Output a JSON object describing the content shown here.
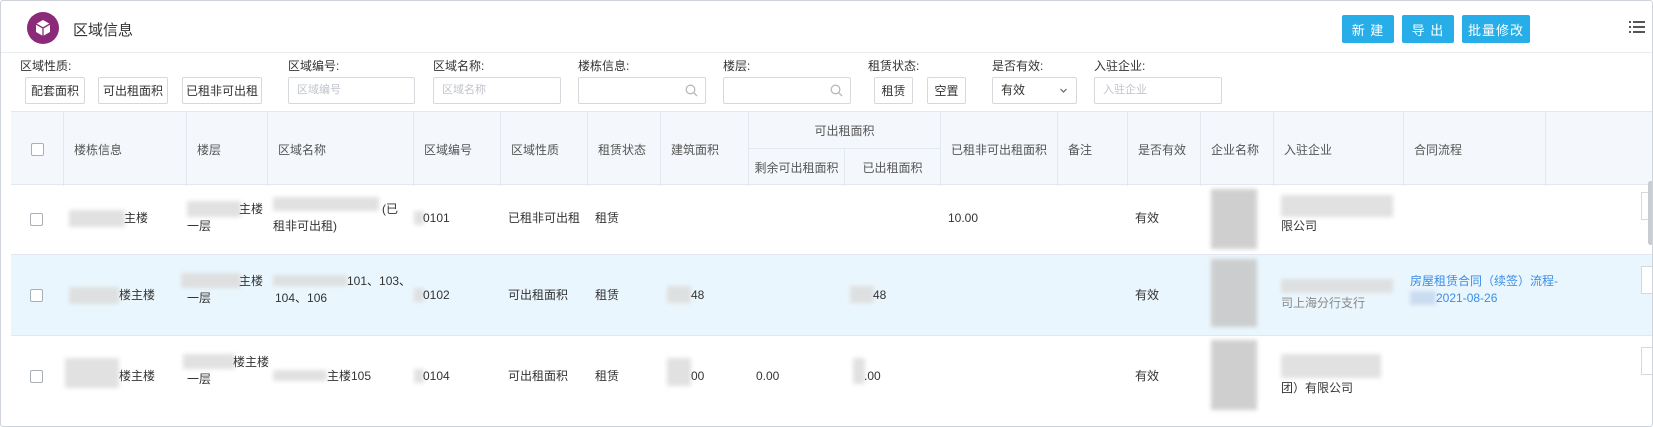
{
  "header": {
    "title": "区域信息",
    "buttons": {
      "new": "新 建",
      "export": "导 出",
      "batch_edit": "批量修改"
    }
  },
  "filters": {
    "area_nature": {
      "label": "区域性质:",
      "options": [
        "配套面积",
        "可出租面积",
        "已租非可出租"
      ]
    },
    "area_code": {
      "label": "区域编号:",
      "placeholder": "区域编号"
    },
    "area_name": {
      "label": "区域名称:",
      "placeholder": "区域名称"
    },
    "building": {
      "label": "楼栋信息:"
    },
    "floor": {
      "label": "楼层:"
    },
    "lease_status": {
      "label": "租赁状态:",
      "options": [
        "租赁",
        "空置"
      ]
    },
    "valid": {
      "label": "是否有效:",
      "value": "有效"
    },
    "tenant": {
      "label": "入驻企业:",
      "placeholder": "入驻企业"
    }
  },
  "table": {
    "columns": {
      "building": "楼栋信息",
      "floor": "楼层",
      "area_name": "区域名称",
      "area_code": "区域编号",
      "area_nature": "区域性质",
      "lease_status": "租赁状态",
      "build_area": "建筑面积",
      "rentable_group": "可出租面积",
      "remaining": "剩余可出租面积",
      "rented": "已出租面积",
      "rented_non_rentable": "已租非可出租面积",
      "remark": "备注",
      "valid": "是否有效",
      "company": "企业名称",
      "tenant": "入驻企业",
      "contract": "合同流程",
      "partial": "操"
    },
    "rows": [
      {
        "building": "主楼",
        "floor_a": "主楼",
        "floor_b": "一层",
        "name_a": "(已",
        "name_b": "租非可出租)",
        "code": "0101",
        "nature": "已租非可出租",
        "status": "租赁",
        "build_area": "",
        "remaining": "",
        "rented": "",
        "rnr": "10.00",
        "valid": "有效",
        "tenant": "限公司",
        "contract_a": "",
        "contract_b": ""
      },
      {
        "building": "楼主楼",
        "floor_a": "主楼",
        "floor_b": "一层",
        "name_a": "101、103、",
        "name_b": "104、106",
        "code": "0102",
        "nature": "可出租面积",
        "status": "租赁",
        "build_area": "48",
        "remaining": "",
        "rented": "48",
        "rnr": "",
        "valid": "有效",
        "tenant": "司上海分行支行",
        "contract_a": "房屋租赁合同（续签）流程-",
        "contract_b": "2021-08-26"
      },
      {
        "building": "楼主楼",
        "floor_a": "楼主楼",
        "floor_b": "一层",
        "name_a": "主楼105",
        "name_b": "",
        "code": "0104",
        "nature": "可出租面积",
        "status": "租赁",
        "build_area": "00",
        "remaining": "0.00",
        "rented": ".00",
        "rnr": "",
        "valid": "有效",
        "tenant": "团）有限公司",
        "contract_a": "",
        "contract_b": ""
      }
    ]
  },
  "colors": {
    "accent": "#27aee9",
    "logo": "#8a2a78",
    "link": "#3a8ee6",
    "highlight_row": "#eaf6fd"
  },
  "icons": [
    "cube-logo-icon",
    "search-icon",
    "chevron-down-icon",
    "list-menu-icon",
    "checkbox-icon"
  ]
}
